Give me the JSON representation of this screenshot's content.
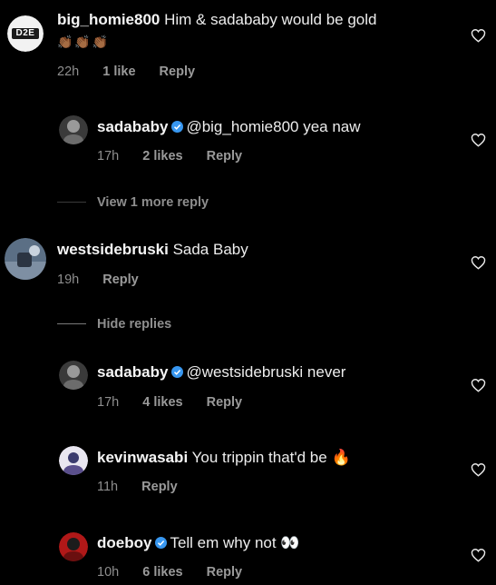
{
  "comments": [
    {
      "username": "big_homie800",
      "text": "Him & sadababy would be gold",
      "extra_line": "👏🏾👏🏾👏🏾",
      "time": "22h",
      "likes": "1 like",
      "reply": "Reply",
      "avatar_text": "D2E"
    },
    {
      "username": "sadababy",
      "text": "@big_homie800 yea naw",
      "time": "17h",
      "likes": "2 likes",
      "reply": "Reply"
    },
    {
      "username": "westsidebruski",
      "text": "Sada Baby",
      "time": "19h",
      "reply": "Reply"
    },
    {
      "username": "sadababy",
      "text": "@westsidebruski never",
      "time": "17h",
      "likes": "4 likes",
      "reply": "Reply"
    },
    {
      "username": "kevinwasabi",
      "text": "You trippin that'd be 🔥",
      "time": "11h",
      "reply": "Reply"
    },
    {
      "username": "doeboy",
      "text": "Tell em why not 👀",
      "time": "10h",
      "likes": "6 likes",
      "reply": "Reply"
    }
  ],
  "threads": {
    "view_more": "View 1 more reply",
    "hide_replies": "Hide replies"
  },
  "colors": {
    "background": "#000000",
    "text": "#ededed",
    "meta": "#8e8e8e",
    "verified": "#3897f0"
  },
  "icons": {
    "like": "heart-outline-icon",
    "verified": "verified-badge-icon"
  }
}
